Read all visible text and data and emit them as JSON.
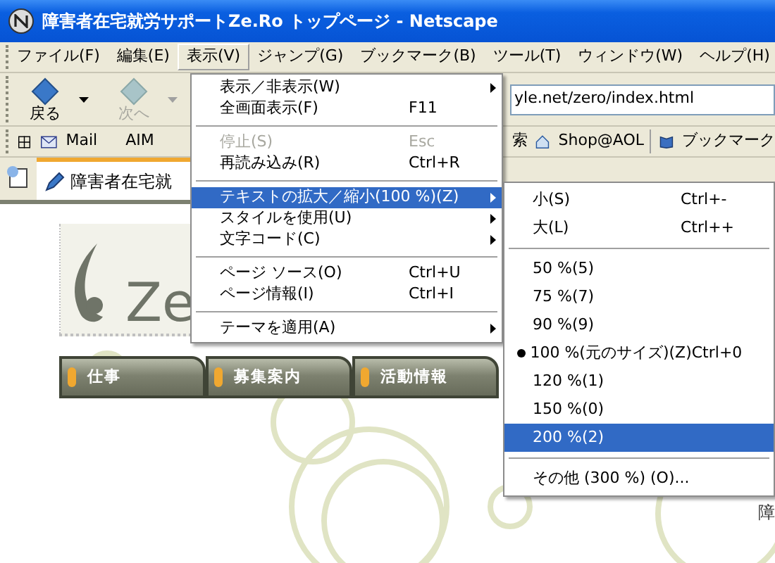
{
  "window": {
    "title": "障害者在宅就労サポートZe.Ro トップページ - Netscape"
  },
  "menubar": [
    {
      "label": "ファイル(F)",
      "selected": false
    },
    {
      "label": "編集(E)",
      "selected": false
    },
    {
      "label": "表示(V)",
      "selected": true
    },
    {
      "label": "ジャンプ(G)",
      "selected": false
    },
    {
      "label": "ブックマーク(B)",
      "selected": false
    },
    {
      "label": "ツール(T)",
      "selected": false
    },
    {
      "label": "ウィンドウ(W)",
      "selected": false
    },
    {
      "label": "ヘルプ(H)",
      "selected": false
    }
  ],
  "nav_toolbar": {
    "back": {
      "label": "戻る",
      "disabled": false
    },
    "forward": {
      "label": "次へ",
      "disabled": true
    },
    "url": {
      "value": "yle.net/zero/index.html"
    }
  },
  "personal_toolbar": [
    {
      "label": "Mail"
    },
    {
      "label": "AIM"
    },
    {
      "label": "索"
    },
    {
      "label": "Shop@AOL"
    },
    {
      "label": "ブックマーク"
    }
  ],
  "tab": {
    "title": "障害者在宅就"
  },
  "page": {
    "logo_text": "Ze",
    "nav": [
      {
        "label": "仕事"
      },
      {
        "label": "募集案内"
      },
      {
        "label": "活動情報"
      }
    ],
    "corner_text": "障"
  },
  "view_menu": [
    {
      "kind": "item",
      "label": "表示／非表示(W)",
      "submenu": true,
      "disabled": false,
      "selected": false
    },
    {
      "kind": "item",
      "label": "全画面表示(F)",
      "shortcut": "F11",
      "disabled": false,
      "selected": false
    },
    {
      "kind": "separator"
    },
    {
      "kind": "item",
      "label": "停止(S)",
      "shortcut": "Esc",
      "disabled": true,
      "selected": false
    },
    {
      "kind": "item",
      "label": "再読み込み(R)",
      "shortcut": "Ctrl+R",
      "disabled": false,
      "selected": false
    },
    {
      "kind": "separator"
    },
    {
      "kind": "item",
      "label": "テキストの拡大／縮小(100 %)(Z)",
      "submenu": true,
      "disabled": false,
      "selected": true
    },
    {
      "kind": "item",
      "label": "スタイルを使用(U)",
      "submenu": true,
      "disabled": false,
      "selected": false
    },
    {
      "kind": "item",
      "label": "文字コード(C)",
      "submenu": true,
      "disabled": false,
      "selected": false
    },
    {
      "kind": "separator"
    },
    {
      "kind": "item",
      "label": "ページ ソース(O)",
      "shortcut": "Ctrl+U",
      "disabled": false,
      "selected": false
    },
    {
      "kind": "item",
      "label": "ページ情報(I)",
      "shortcut": "Ctrl+I",
      "disabled": false,
      "selected": false
    },
    {
      "kind": "separator"
    },
    {
      "kind": "item",
      "label": "テーマを適用(A)",
      "submenu": true,
      "disabled": false,
      "selected": false
    }
  ],
  "zoom_menu": [
    {
      "kind": "item",
      "label": "小(S)",
      "shortcut": "Ctrl+-",
      "checked": false,
      "selected": false
    },
    {
      "kind": "item",
      "label": "大(L)",
      "shortcut": "Ctrl++",
      "checked": false,
      "selected": false
    },
    {
      "kind": "separator"
    },
    {
      "kind": "item",
      "label": "50 %(5)",
      "checked": false,
      "selected": false
    },
    {
      "kind": "item",
      "label": "75 %(7)",
      "checked": false,
      "selected": false
    },
    {
      "kind": "item",
      "label": "90 %(9)",
      "checked": false,
      "selected": false
    },
    {
      "kind": "item",
      "label": "100 %(元のサイズ)(Z)",
      "shortcut": "Ctrl+0",
      "checked": true,
      "selected": false
    },
    {
      "kind": "item",
      "label": "120 %(1)",
      "checked": false,
      "selected": false
    },
    {
      "kind": "item",
      "label": "150 %(0)",
      "checked": false,
      "selected": false
    },
    {
      "kind": "item",
      "label": "200 %(2)",
      "checked": false,
      "selected": true
    },
    {
      "kind": "separator"
    },
    {
      "kind": "item",
      "label": "その他 (300 %) (O)...",
      "checked": false,
      "selected": false
    }
  ]
}
